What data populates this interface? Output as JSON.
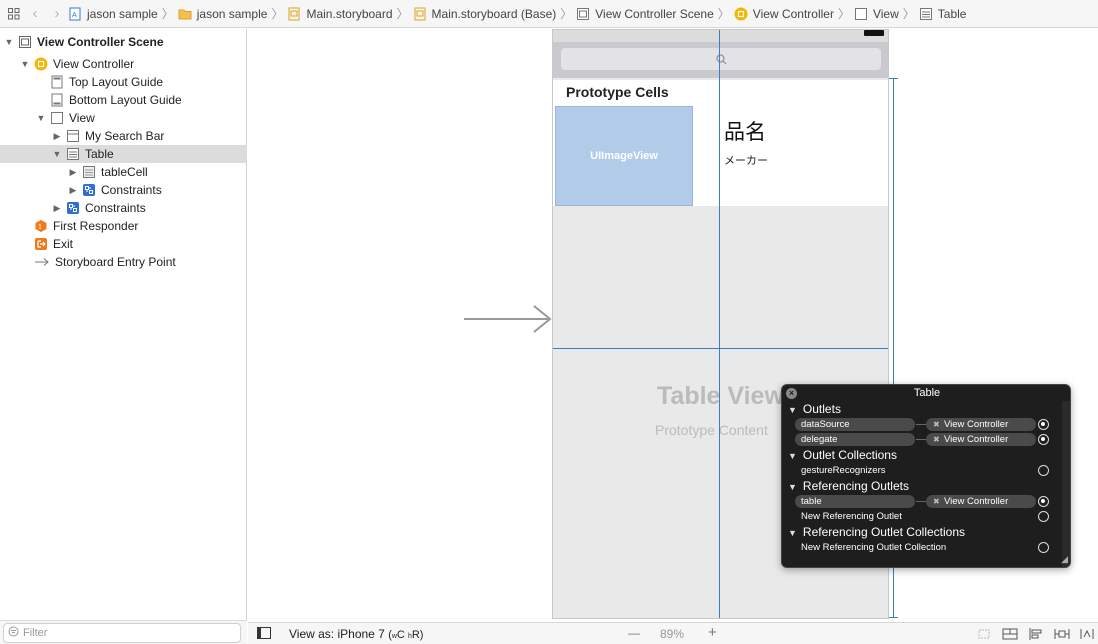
{
  "jumpbar": {
    "crumbs": [
      {
        "label": "jason sample",
        "icon": "project-file-icon"
      },
      {
        "label": "jason sample",
        "icon": "folder-icon"
      },
      {
        "label": "Main.storyboard",
        "icon": "storyboard-icon"
      },
      {
        "label": "Main.storyboard (Base)",
        "icon": "storyboard-icon"
      },
      {
        "label": "View Controller Scene",
        "icon": "scene-icon"
      },
      {
        "label": "View Controller",
        "icon": "view-controller-icon"
      },
      {
        "label": "View",
        "icon": "view-icon"
      },
      {
        "label": "Table",
        "icon": "table-icon"
      }
    ]
  },
  "outline": {
    "items": [
      {
        "label": "View Controller Scene"
      },
      {
        "label": "View Controller"
      },
      {
        "label": "Top Layout Guide"
      },
      {
        "label": "Bottom Layout Guide"
      },
      {
        "label": "View"
      },
      {
        "label": "My Search Bar"
      },
      {
        "label": "Table"
      },
      {
        "label": "tableCell"
      },
      {
        "label": "Constraints"
      },
      {
        "label": "Constraints"
      },
      {
        "label": "First Responder"
      },
      {
        "label": "Exit"
      },
      {
        "label": "Storyboard Entry Point"
      }
    ],
    "filter_placeholder": "Filter"
  },
  "canvas": {
    "prototype_cells_label": "Prototype Cells",
    "image_view_label": "UIImageView",
    "cell_title": "品名",
    "cell_subtitle": "メーカー",
    "table_view_title": "Table View",
    "table_view_subtitle": "Prototype Content"
  },
  "connections": {
    "title": "Table",
    "sections": {
      "outlets": "Outlets",
      "outlet_collections": "Outlet Collections",
      "referencing_outlets": "Referencing Outlets",
      "referencing_outlet_collections": "Referencing Outlet Collections"
    },
    "rows": {
      "datasource": {
        "name": "dataSource",
        "target": "View Controller"
      },
      "delegate": {
        "name": "delegate",
        "target": "View Controller"
      },
      "gesture": {
        "name": "gestureRecognizers"
      },
      "table": {
        "name": "table",
        "target": "View Controller"
      },
      "new_ref": {
        "name": "New Referencing Outlet"
      },
      "new_ref_coll": {
        "name": "New Referencing Outlet Collection"
      }
    }
  },
  "bottombar": {
    "view_as": "View as: iPhone 7",
    "size_class_w": "w",
    "size_class_c": "C",
    "size_class_h": "h",
    "size_class_r": "R",
    "zoom": "89%",
    "zoom_out": "—",
    "zoom_in": "+"
  },
  "colors": {
    "accent_blue": "#3a7fc1",
    "image_view_fill": "#b2cbe8",
    "popover_bg": "#1e1e1e",
    "vc_yellow": "#f6b500"
  }
}
